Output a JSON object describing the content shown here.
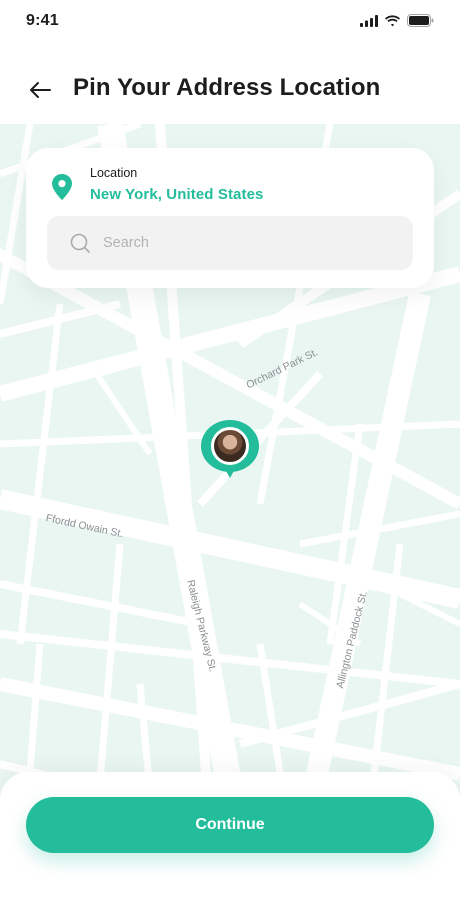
{
  "status_bar": {
    "time": "9:41",
    "icons": [
      "cellular-signal-icon",
      "wifi-icon",
      "battery-icon"
    ]
  },
  "header": {
    "title": "Pin Your Address Location",
    "back_icon": "arrow-left-icon"
  },
  "location_card": {
    "label": "Location",
    "value": "New York, United States",
    "icon": "location-pin-icon",
    "search": {
      "placeholder": "Search",
      "value": "",
      "icon": "search-icon"
    }
  },
  "map": {
    "streets": [
      "Orchard Park St.",
      "Ffordd Owain St.",
      "Raleigh Parkway St.",
      "Allington Paddock St."
    ],
    "marker": "user-avatar-pin"
  },
  "footer": {
    "continue_label": "Continue"
  },
  "colors": {
    "accent": "#23bd9b",
    "map_background": "#e9f6f2",
    "road": "#ffffff",
    "title": "#1d1d1d",
    "muted_text": "#8a8f92",
    "search_background": "#f2f2f2"
  }
}
